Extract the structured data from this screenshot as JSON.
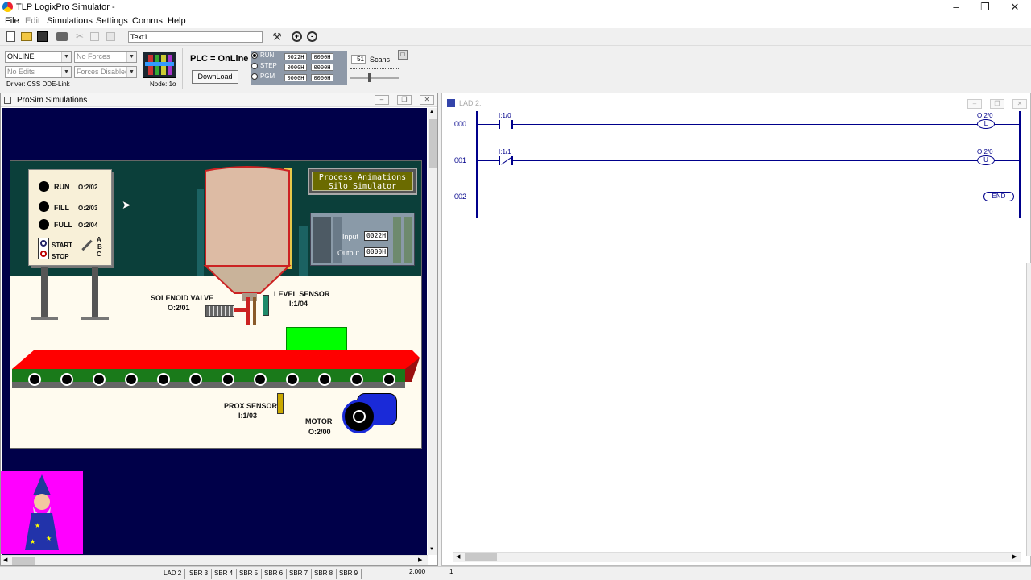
{
  "app": {
    "title": "TLP LogixPro Simulator  -"
  },
  "menu": [
    "File",
    "Edit",
    "Simulations",
    "Settings",
    "Comms",
    "Help"
  ],
  "toolbar": {
    "text_field": "Text1"
  },
  "status_panel": {
    "mode_select": "ONLINE",
    "forces_select": "No Forces",
    "edits_select": "No Edits",
    "forces_enabled_select": "Forces Disabled",
    "driver": "Driver: CSS DDE-Link",
    "node": "Node: 1o",
    "plc_status": "PLC = OnLine",
    "download_button": "DownLoad",
    "modes": [
      "RUN",
      "STEP",
      "PGM"
    ],
    "hex_values": [
      [
        "0022H",
        "0000H"
      ],
      [
        "0000H",
        "0000H"
      ],
      [
        "0000H",
        "0000H"
      ]
    ],
    "scans_value": "51",
    "scans_label": "Scans"
  },
  "prosim": {
    "title": "ProSim Simulations",
    "lights": [
      {
        "label": "RUN",
        "addr": "O:2/02"
      },
      {
        "label": "FILL",
        "addr": "O:2/03"
      },
      {
        "label": "FULL",
        "addr": "O:2/04"
      }
    ],
    "start_label": "START",
    "stop_label": "STOP",
    "selector": [
      "A",
      "B",
      "C"
    ],
    "banner": [
      "Process Animations",
      "Silo Simulator"
    ],
    "plc_io": {
      "input_label": "Input",
      "input_value": "0022H",
      "output_label": "Output",
      "output_value": "0000H"
    },
    "solenoid": {
      "label": "SOLENOID VALVE",
      "addr": "O:2/01"
    },
    "level_sensor": {
      "label": "LEVEL SENSOR",
      "addr": "I:1/04"
    },
    "prox_sensor": {
      "label": "PROX SENSOR",
      "addr": "I:1/03"
    },
    "motor": {
      "label": "MOTOR",
      "addr": "O:2/00"
    },
    "colors": {
      "background": "#000049",
      "conveyor": "#ff0000",
      "box": "#00ff00",
      "wizard_bg": "#ff00ff"
    }
  },
  "ladder": {
    "title": "LAD 2:",
    "rungs": [
      {
        "num": "000",
        "contact": "I:1/0",
        "coil": "O:2/0",
        "coil_type": "L"
      },
      {
        "num": "001",
        "contact": "I:1/1",
        "coil": "O:2/0",
        "coil_type": "U"
      },
      {
        "num": "002",
        "end": "END"
      }
    ]
  },
  "status_tabs": [
    "LAD 2",
    "SBR 3",
    "SBR 4",
    "SBR 5",
    "SBR 6",
    "SBR 7",
    "SBR 8",
    "SBR 9"
  ],
  "status_zoom": "2.000",
  "status_position": "1"
}
